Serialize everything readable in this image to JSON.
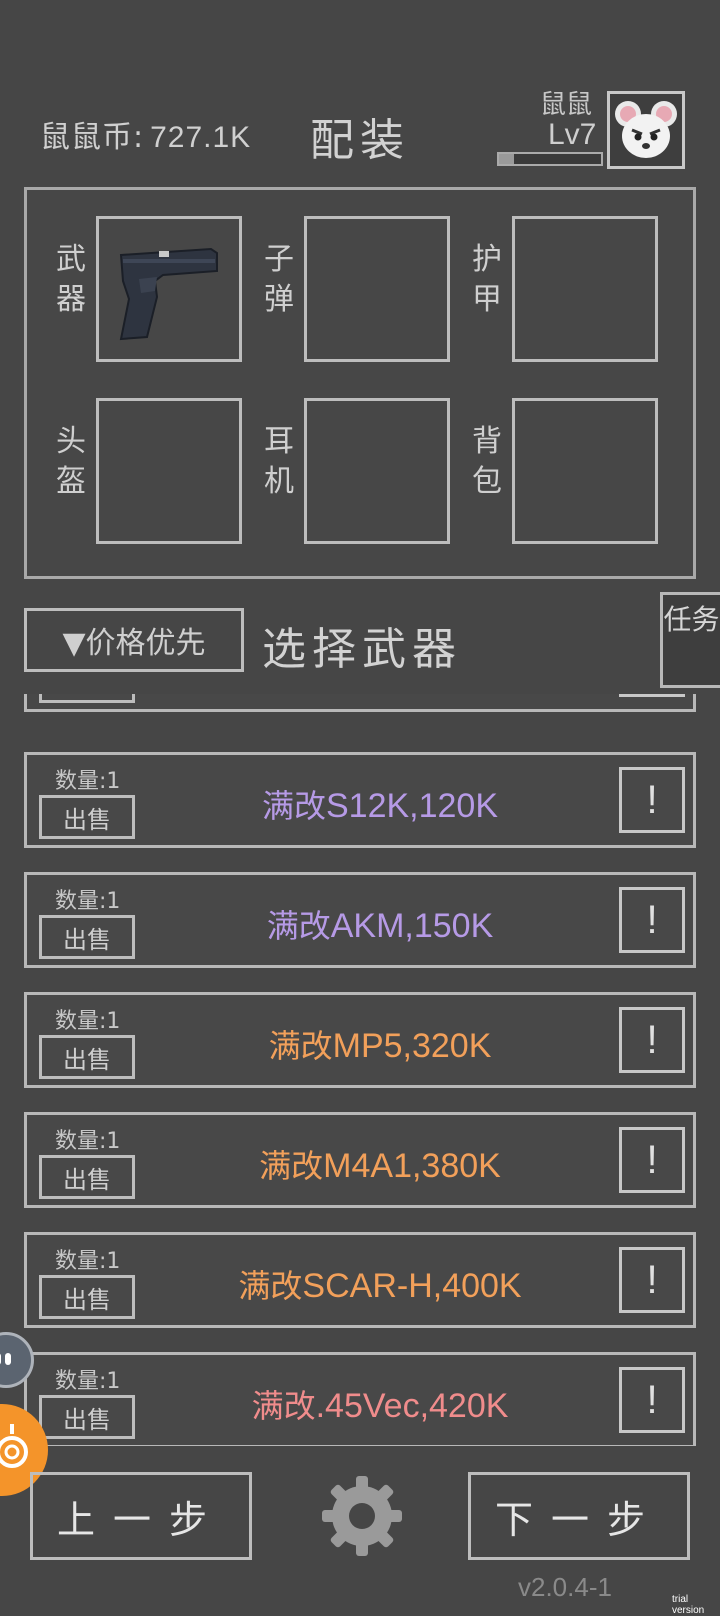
{
  "header": {
    "coins_label": "鼠鼠币:",
    "coins_value": "727.1K",
    "title": "配装",
    "player_name": "鼠鼠",
    "player_level": "Lv7",
    "xp_fraction": 0.15
  },
  "equipment": {
    "slots": [
      {
        "label": "武器",
        "filled": true,
        "item_icon": "pistol-icon"
      },
      {
        "label": "子弹",
        "filled": false
      },
      {
        "label": "护甲",
        "filled": false
      },
      {
        "label": "头盔",
        "filled": false
      },
      {
        "label": "耳机",
        "filled": false
      },
      {
        "label": "背包",
        "filled": false
      }
    ]
  },
  "filter": {
    "sort_label": "▼价格优先",
    "section_title": "选择武器",
    "task_label": "任务"
  },
  "items": [
    {
      "qty": "数量:1",
      "sell": "出售",
      "prefix": "满改",
      "name": "S12K,120K",
      "color": "#b69ae6",
      "info": "!"
    },
    {
      "qty": "数量:1",
      "sell": "出售",
      "prefix": "满改",
      "name": "AKM,150K",
      "color": "#b69ae6",
      "info": "!"
    },
    {
      "qty": "数量:1",
      "sell": "出售",
      "prefix": "满改",
      "name": "MP5,320K",
      "color": "#f2a05a",
      "info": "!"
    },
    {
      "qty": "数量:1",
      "sell": "出售",
      "prefix": "满改",
      "name": "M4A1,380K",
      "color": "#f2a05a",
      "info": "!"
    },
    {
      "qty": "数量:1",
      "sell": "出售",
      "prefix": "满改",
      "name": "SCAR-H,400K",
      "color": "#f2a05a",
      "info": "!"
    },
    {
      "qty": "数量:1",
      "sell": "出售",
      "prefix": "满改",
      "name": ".45Vec,420K",
      "color": "#f08c8c",
      "info": "!"
    }
  ],
  "footer": {
    "prev_label": "上一步",
    "next_label": "下一步",
    "version": "v2.0.4-1",
    "trial": "trial version"
  },
  "colors": {
    "background": "#464646",
    "border": "#bdbdbd",
    "purple_tier": "#b69ae6",
    "orange_tier": "#f2a05a",
    "red_tier": "#f08c8c"
  }
}
